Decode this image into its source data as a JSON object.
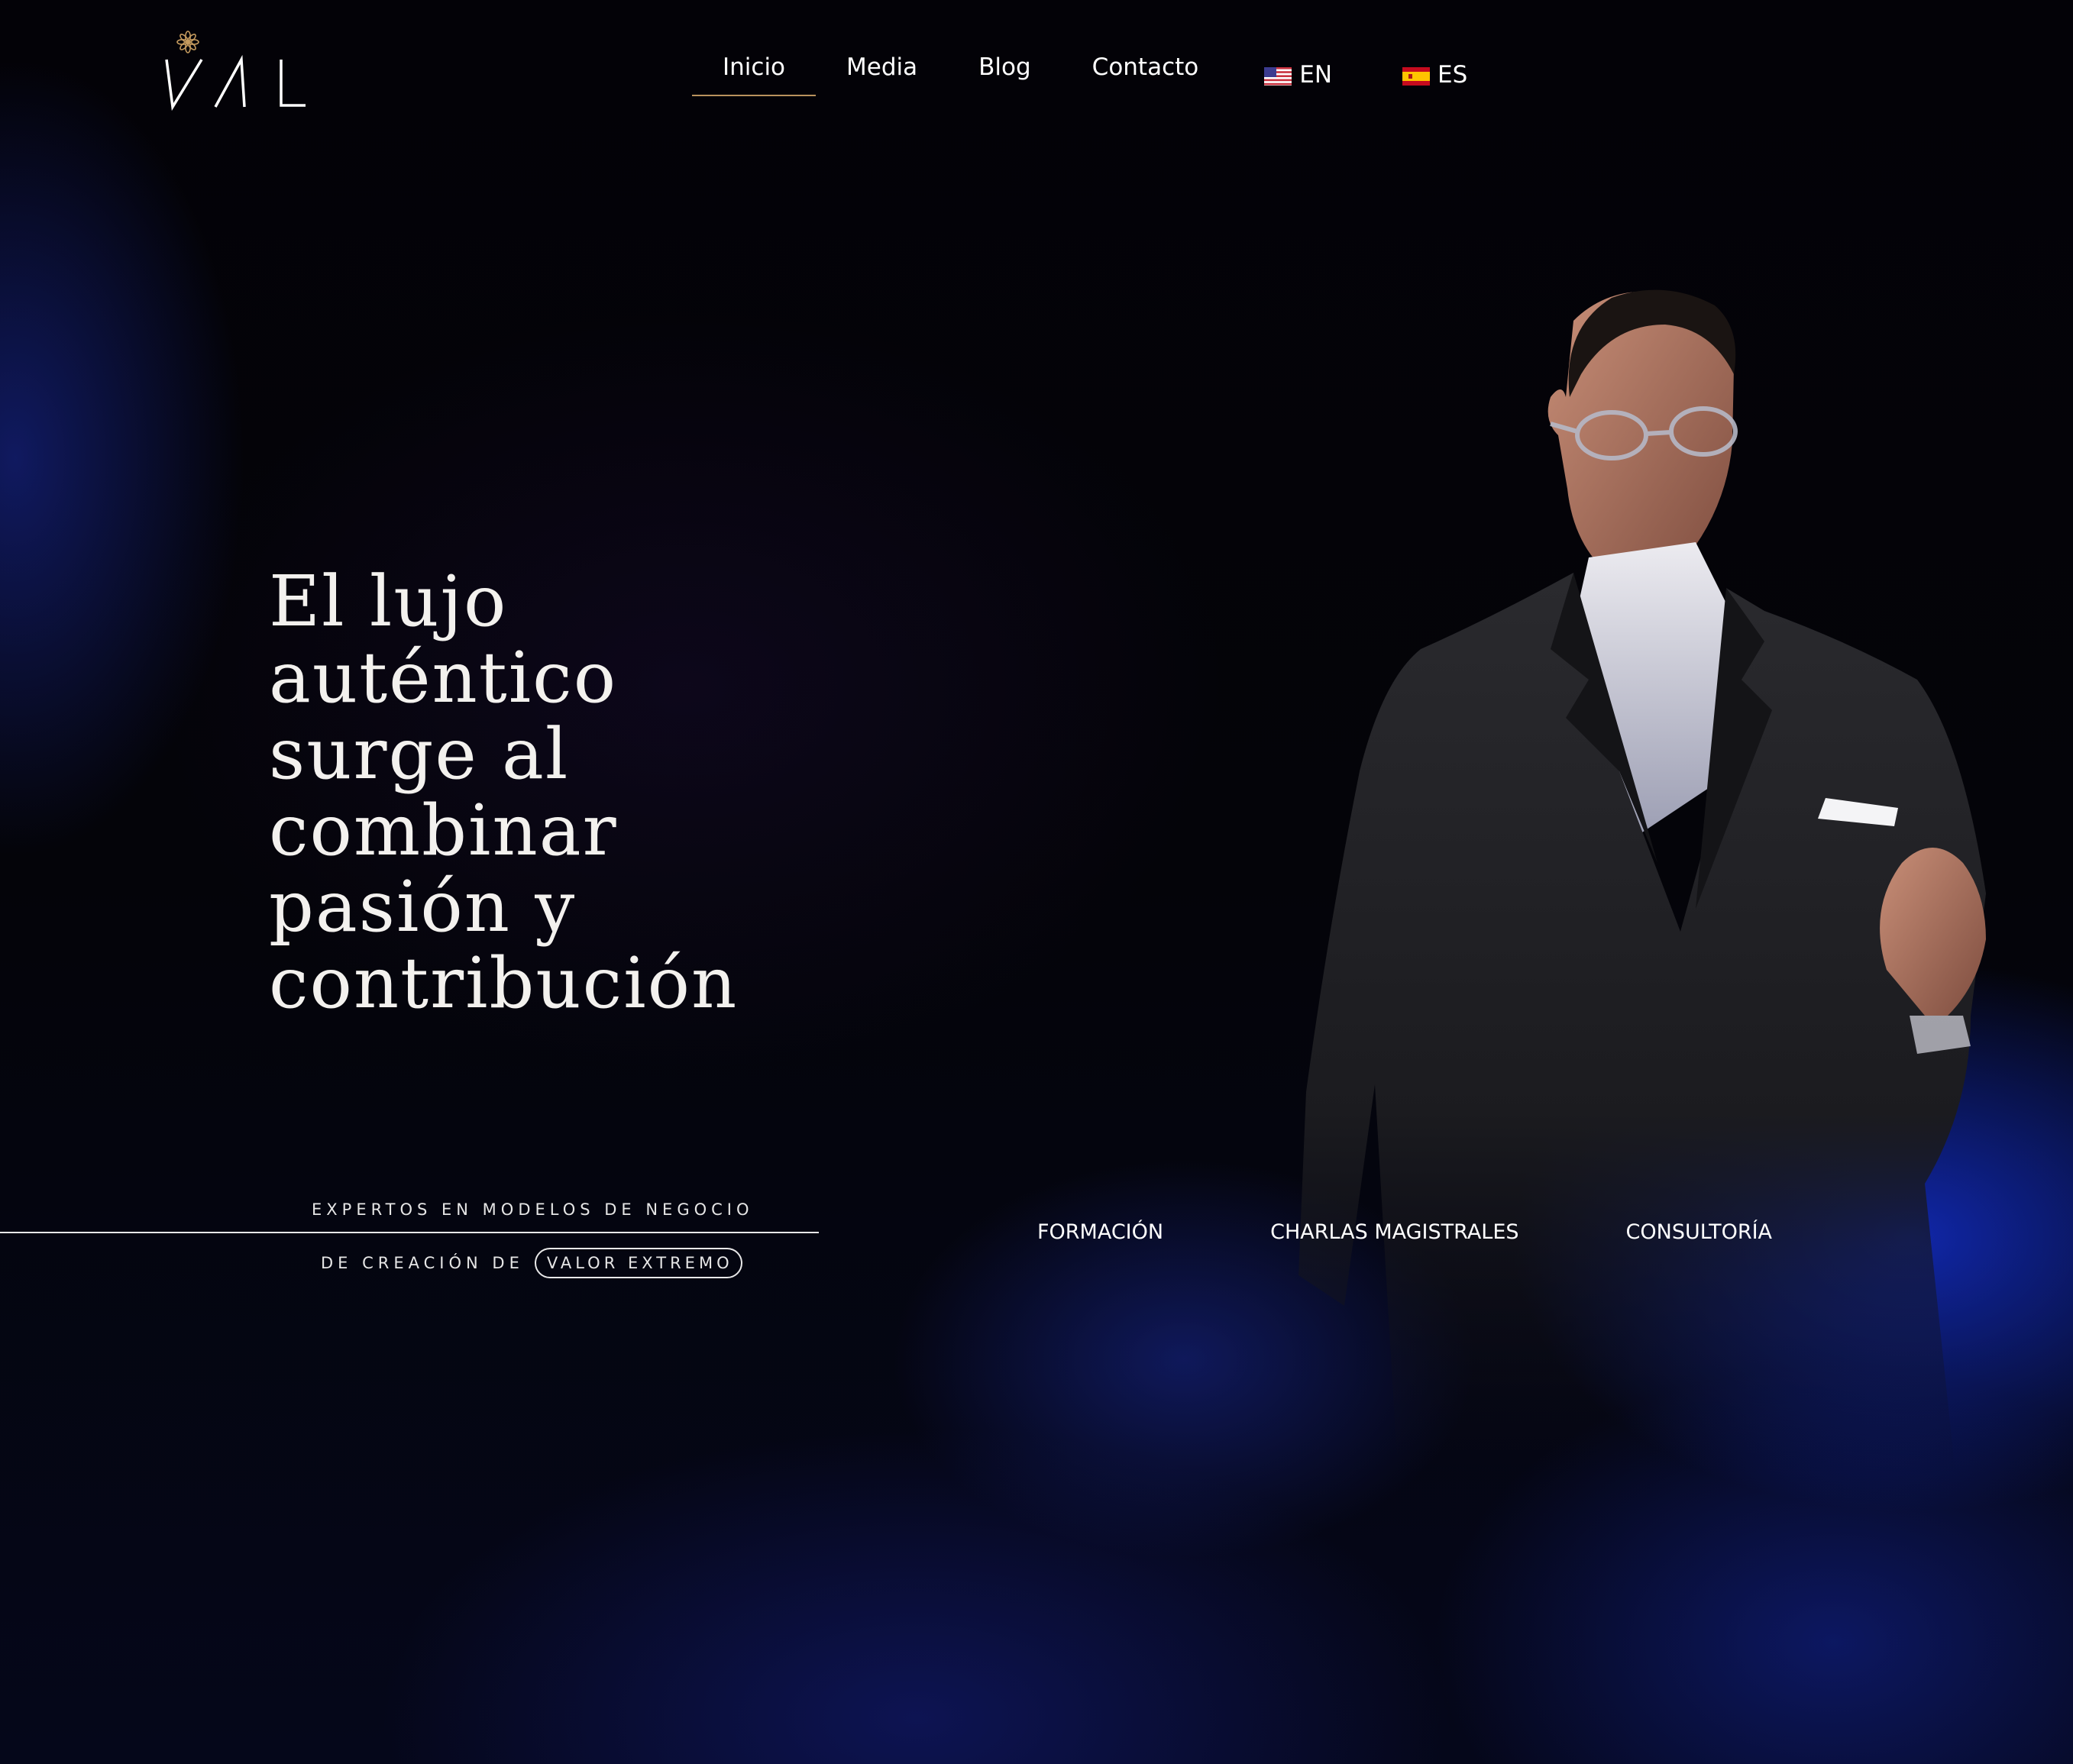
{
  "header": {
    "logo_text": "VAL",
    "nav": [
      {
        "label": "Inicio",
        "active": true
      },
      {
        "label": "Media",
        "active": false
      },
      {
        "label": "Blog",
        "active": false
      },
      {
        "label": "Contacto",
        "active": false
      }
    ],
    "languages": [
      {
        "code": "EN",
        "flag": "us-flag-icon"
      },
      {
        "code": "ES",
        "flag": "es-flag-icon"
      }
    ]
  },
  "hero": {
    "title_lines": [
      "El lujo",
      "auténtico",
      "surge al",
      "combinar",
      "pasión y",
      "contribución"
    ],
    "tagline_top": "EXPERTOS EN MODELOS DE NEGOCIO",
    "tagline_bottom_prefix": "DE CREACIÓN DE",
    "tagline_bottom_highlight": "VALOR EXTREMO"
  },
  "services": [
    {
      "label": "FORMACIÓN"
    },
    {
      "label": "CHARLAS MAGISTRALES"
    },
    {
      "label": "CONSULTORÍA"
    }
  ],
  "colors": {
    "background": "#020206",
    "accent_gold": "#b9925d",
    "glow_blue": "#1432dc",
    "text": "#ffffff"
  }
}
